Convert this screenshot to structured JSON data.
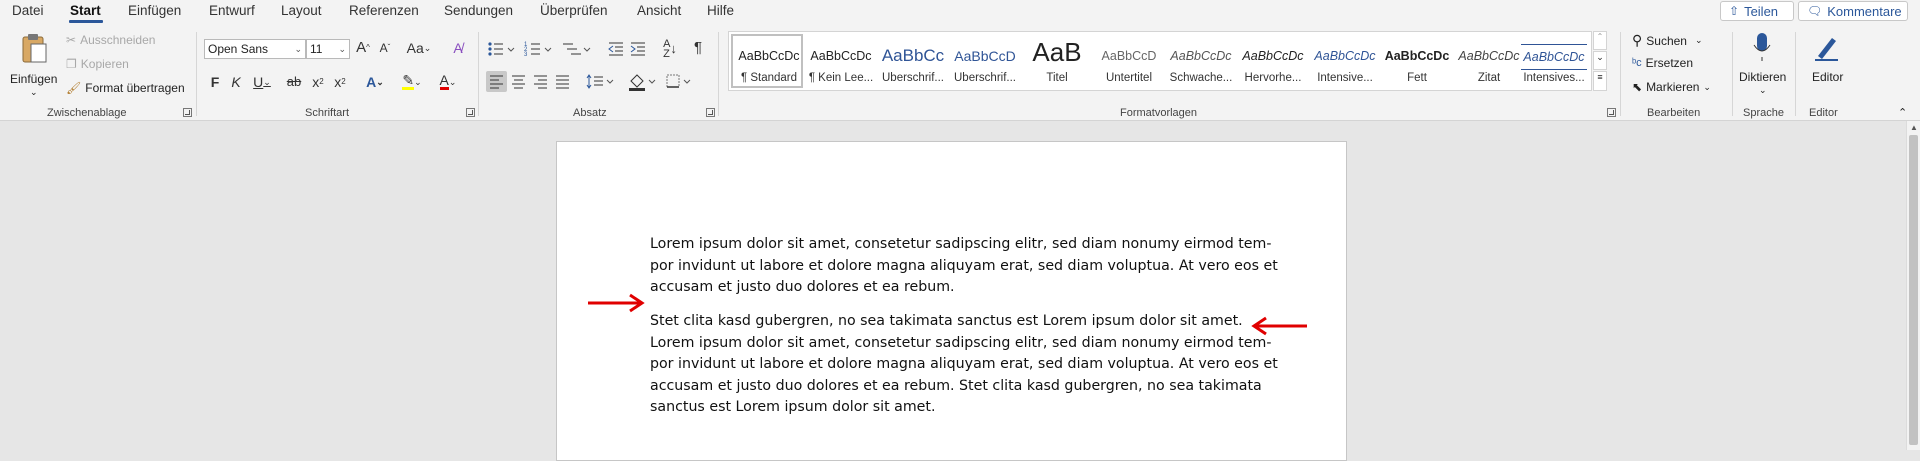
{
  "menu": {
    "tabs": [
      "Datei",
      "Start",
      "Einfügen",
      "Entwurf",
      "Layout",
      "Referenzen",
      "Sendungen",
      "Überprüfen",
      "Ansicht",
      "Hilfe"
    ],
    "share": "Teilen",
    "comments": "Kommentare"
  },
  "clipboard": {
    "paste": "Einfügen",
    "cut": "Ausschneiden",
    "copy": "Kopieren",
    "format_painter": "Format übertragen",
    "label": "Zwischenablage"
  },
  "font": {
    "name": "Open Sans",
    "size": "11",
    "grow": "A",
    "shrink": "A",
    "case": "Aa",
    "bold": "F",
    "italic": "K",
    "underline": "U",
    "strike": "ab",
    "subscript": "x",
    "superscript": "x",
    "effects": "A",
    "font_color": "A",
    "label": "Schriftart",
    "highlight_color": "#ffff00",
    "font_color_hex": "#e00000"
  },
  "paragraph": {
    "pilcrow": "¶",
    "label": "Absatz"
  },
  "styles": {
    "items": [
      {
        "preview": "AaBbCcDc",
        "name": "¶ Standard"
      },
      {
        "preview": "AaBbCcDc",
        "name": "¶ Kein Lee..."
      },
      {
        "preview": "AaBbCc",
        "name": "Überschrif..."
      },
      {
        "preview": "AaBbCcD",
        "name": "Überschrif..."
      },
      {
        "preview": "AaB",
        "name": "Titel"
      },
      {
        "preview": "AaBbCcD",
        "name": "Untertitel"
      },
      {
        "preview": "AaBbCcDc",
        "name": "Schwache..."
      },
      {
        "preview": "AaBbCcDc",
        "name": "Hervorhe..."
      },
      {
        "preview": "AaBbCcDc",
        "name": "Intensive..."
      },
      {
        "preview": "AaBbCcDc",
        "name": "Fett"
      },
      {
        "preview": "AaBbCcDc",
        "name": "Zitat"
      },
      {
        "preview": "AaBbCcDc",
        "name": "Intensives..."
      }
    ],
    "label": "Formatvorlagen"
  },
  "editing": {
    "find": "Suchen",
    "replace": "Ersetzen",
    "select": "Markieren",
    "label": "Bearbeiten"
  },
  "voice": {
    "dictate": "Diktieren",
    "label": "Sprache"
  },
  "editor": {
    "button": "Editor",
    "label": "Editor"
  },
  "document": {
    "paragraph1": [
      "Lorem ipsum dolor sit amet, consetetur sadipscing elitr, sed diam nonumy eirmod tem-",
      "por invidunt ut labore et dolore magna aliquyam erat, sed diam voluptua. At vero eos et",
      "accusam et justo duo dolores et ea rebum."
    ],
    "paragraph2": [
      "Stet clita kasd gubergren, no sea takimata sanctus est Lorem ipsum dolor sit amet.",
      "Lorem ipsum dolor sit amet, consetetur sadipscing elitr, sed diam nonumy eirmod tem-",
      "por invidunt ut labore et dolore magna aliquyam erat, sed diam voluptua. At vero eos et",
      "accusam et justo duo dolores et ea rebum. Stet clita kasd gubergren, no sea takimata",
      "sanctus est Lorem ipsum dolor sit amet."
    ],
    "annotation_color": "#e00000"
  },
  "colors": {
    "accent": "#2b579a"
  }
}
